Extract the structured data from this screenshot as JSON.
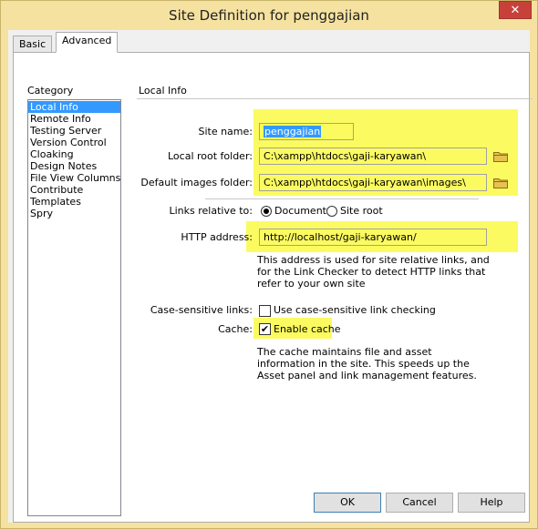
{
  "window": {
    "title": "Site Definition for penggajian",
    "close_glyph": "✕"
  },
  "tabs": [
    {
      "label": "Basic"
    },
    {
      "label": "Advanced"
    }
  ],
  "category": {
    "heading": "Category",
    "items": [
      "Local Info",
      "Remote Info",
      "Testing Server",
      "Version Control",
      "Cloaking",
      "Design Notes",
      "File View Columns",
      "Contribute",
      "Templates",
      "Spry"
    ],
    "selected": "Local Info"
  },
  "local_info": {
    "title": "Local Info",
    "site_name_label": "Site name:",
    "site_name_value": "penggajian",
    "local_root_label": "Local root folder:",
    "local_root_value": "C:\\xampp\\htdocs\\gaji-karyawan\\",
    "default_images_label": "Default images folder:",
    "default_images_value": "C:\\xampp\\htdocs\\gaji-karyawan\\images\\",
    "links_relative_label": "Links relative to:",
    "links_option_document": "Document",
    "links_option_site_root": "Site root",
    "links_selected": "Document",
    "http_address_label": "HTTP address:",
    "http_address_value": "http://localhost/gaji-karyawan/",
    "http_help": "This address is used for site relative links, and for the Link Checker to detect HTTP links that refer to your own site",
    "case_sensitive_label": "Case-sensitive links:",
    "case_sensitive_option": "Use case-sensitive link checking",
    "case_sensitive_checked": false,
    "cache_label": "Cache:",
    "cache_option": "Enable cache",
    "cache_checked": true,
    "cache_check_glyph": "✔",
    "cache_help": "The cache maintains file and asset information in the site.  This speeds up the Asset panel and link management features."
  },
  "buttons": {
    "ok": "OK",
    "cancel": "Cancel",
    "help": "Help"
  },
  "colors": {
    "highlight": "#fbfb61",
    "selection": "#3399ff",
    "title_bar": "#f6e2a0",
    "close": "#c7413a",
    "folder": "#e8c24f"
  },
  "icons": {
    "folder": "folder-icon",
    "close": "close-icon"
  }
}
